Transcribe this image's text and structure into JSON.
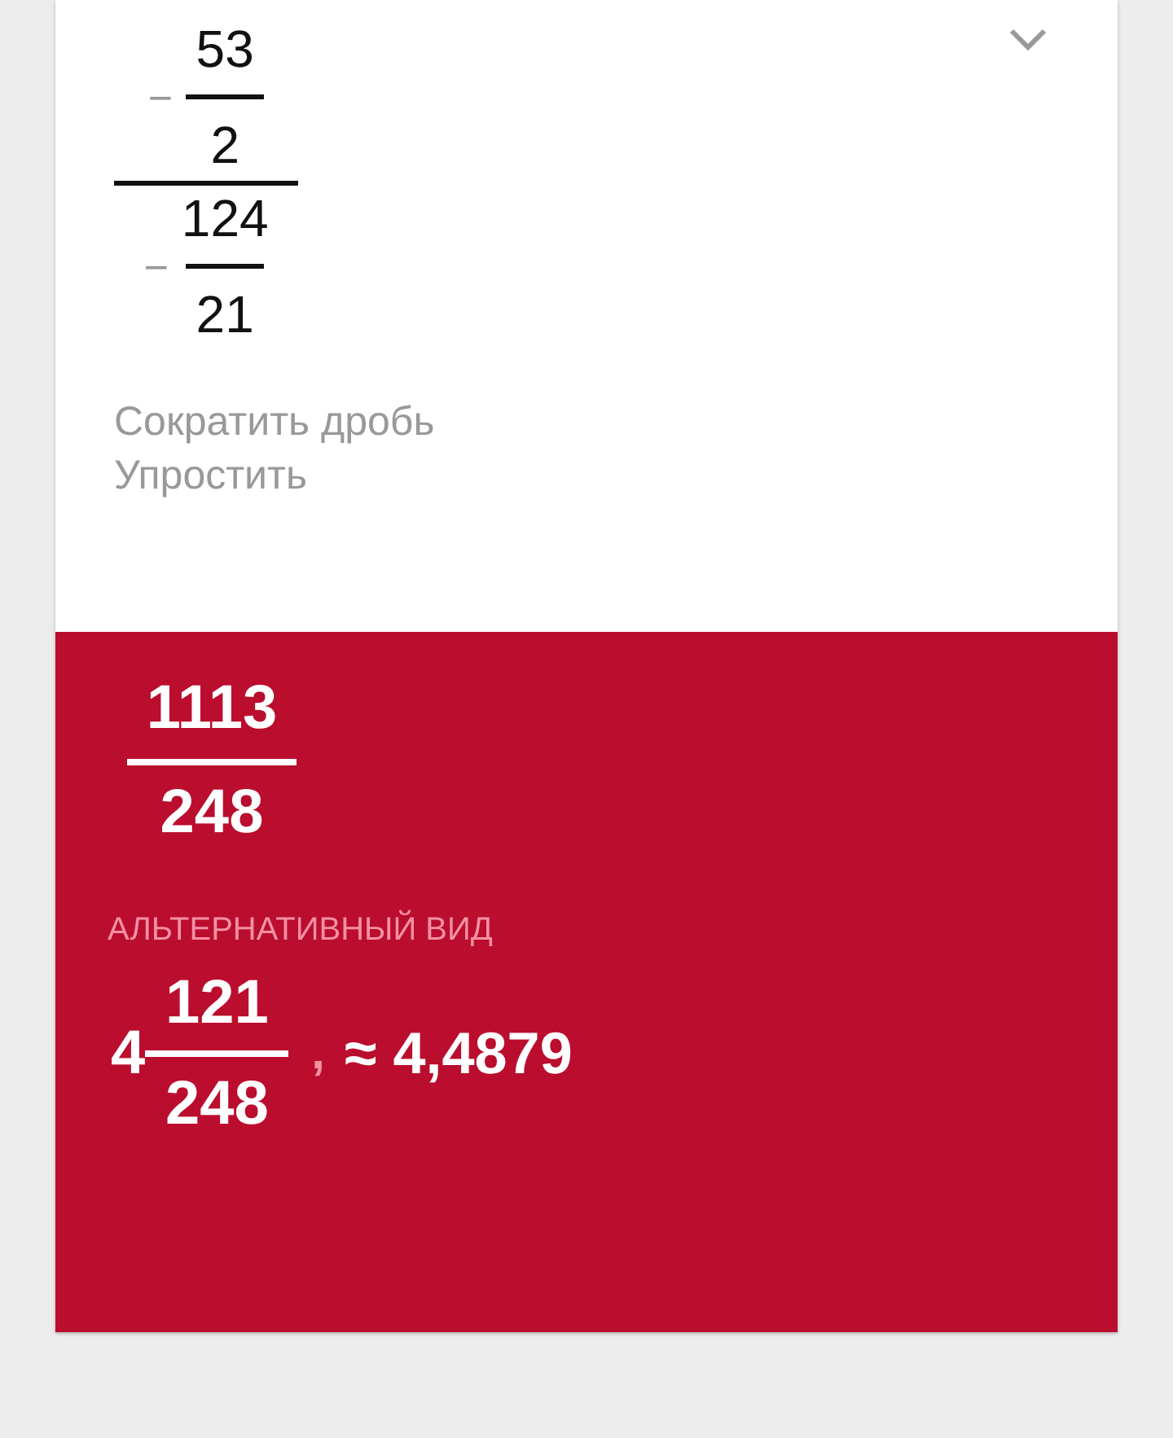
{
  "input": {
    "numerator": {
      "sign": "−",
      "numerator": "53",
      "denominator": "2"
    },
    "denominator": {
      "sign": "−",
      "numerator": "124",
      "denominator": "21"
    }
  },
  "actions": [
    "Сократить дробь",
    "Упростить"
  ],
  "result": {
    "numerator": "1113",
    "denominator": "248"
  },
  "alternative": {
    "label": "АЛЬТЕРНАТИВНЫЙ ВИД",
    "whole": "4",
    "numerator": "121",
    "denominator": "248",
    "separator": ",",
    "approx": "≈ 4,4879"
  }
}
